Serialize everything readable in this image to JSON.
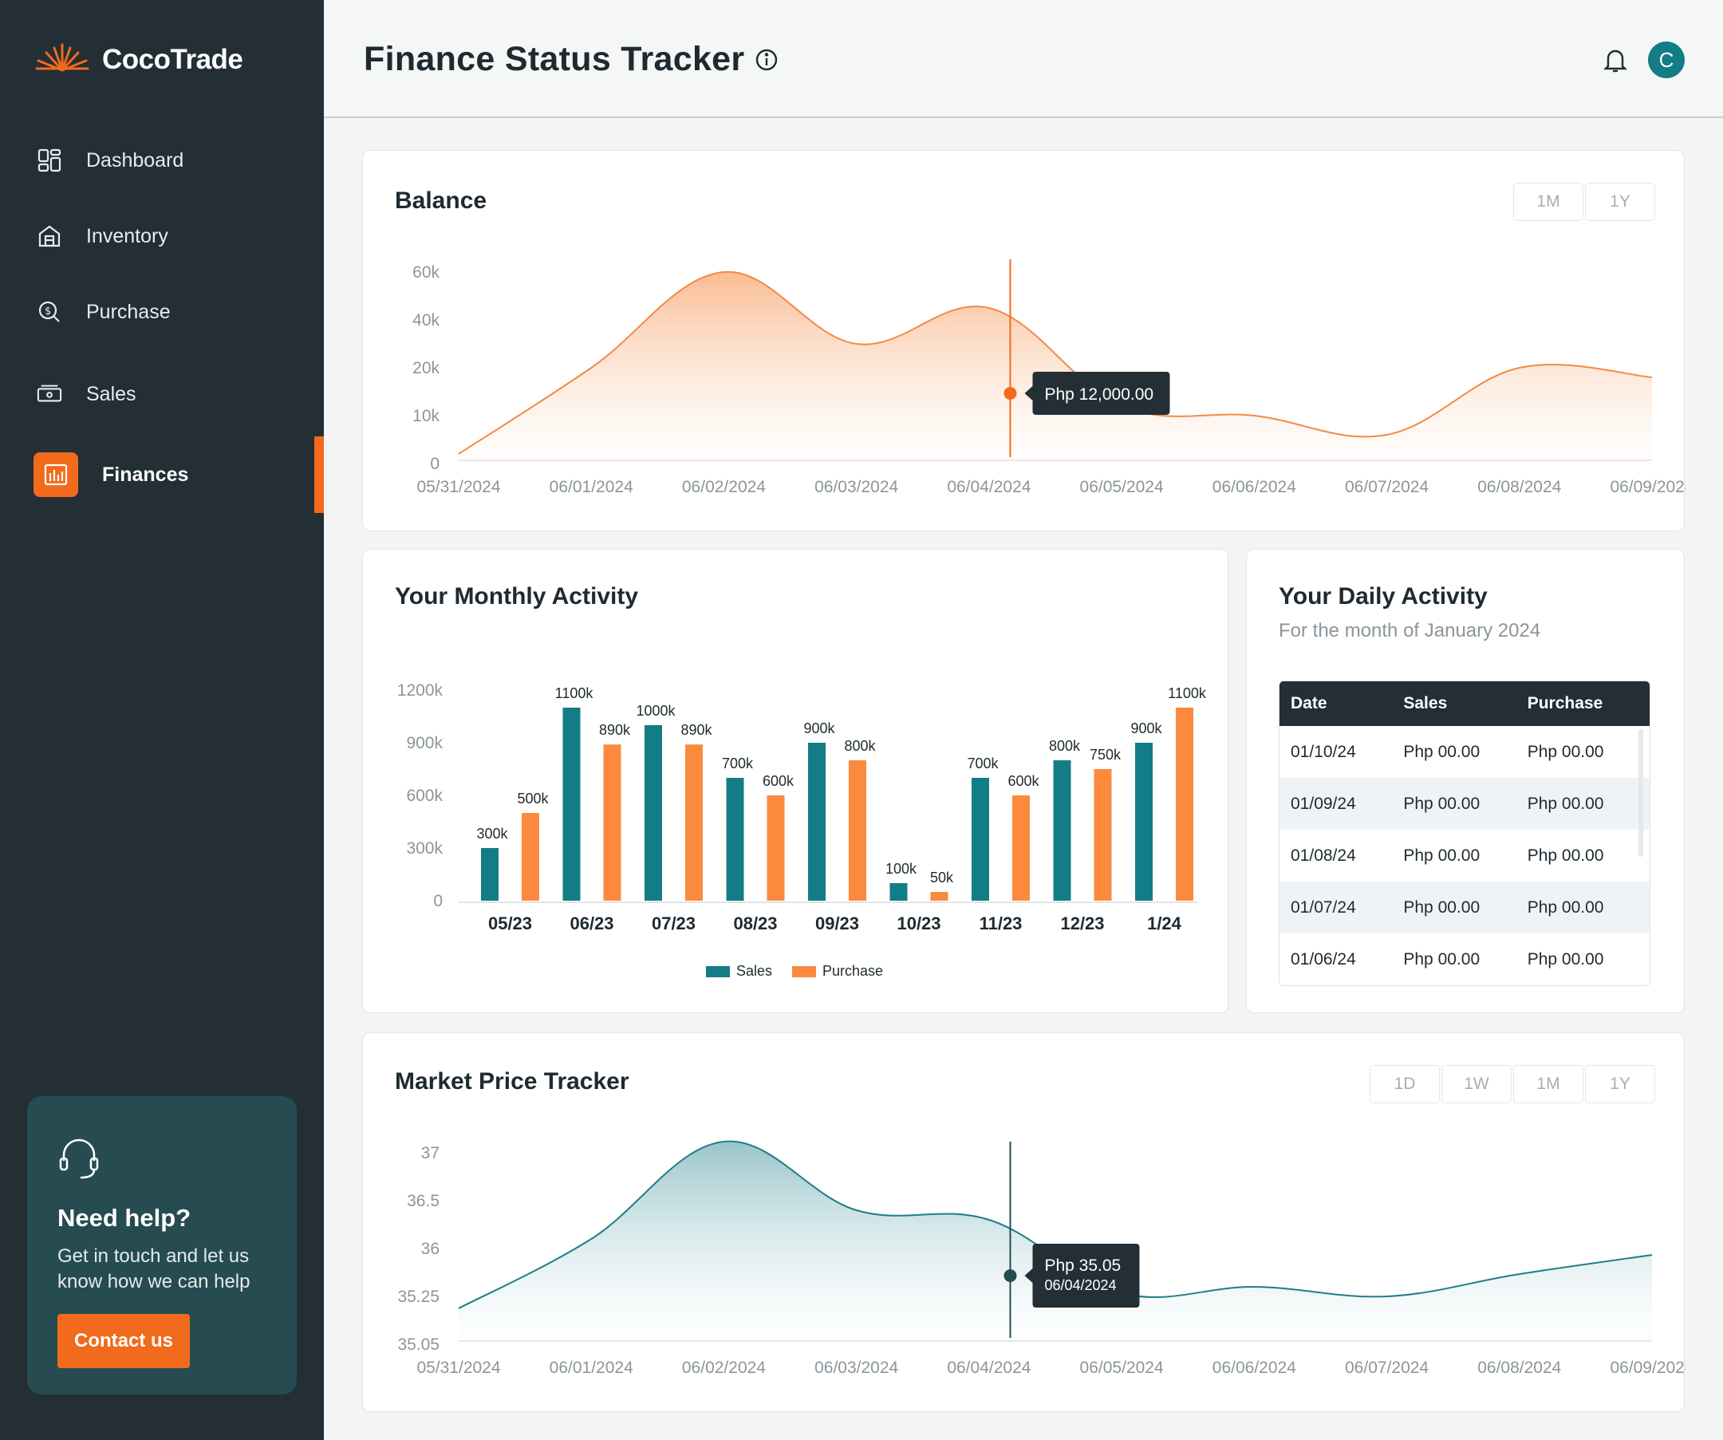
{
  "app": {
    "name": "CocoTrade"
  },
  "sidebar": {
    "items": [
      {
        "label": "Dashboard",
        "icon": "dashboard-icon"
      },
      {
        "label": "Inventory",
        "icon": "warehouse-icon"
      },
      {
        "label": "Purchase",
        "icon": "coin-search-icon"
      },
      {
        "label": "Sales",
        "icon": "cash-icon"
      },
      {
        "label": "Finances",
        "icon": "bar-chart-icon",
        "active": true
      }
    ],
    "help": {
      "title": "Need help?",
      "text": "Get in touch and let us know how we can help",
      "button": "Contact us"
    }
  },
  "header": {
    "title": "Finance Status Tracker",
    "avatar_initial": "C"
  },
  "colors": {
    "accent": "#f26a1b",
    "teal": "#127d86",
    "sidebar": "#232e35",
    "sales": "#127d86",
    "purchase": "#fb8a3e"
  },
  "balance": {
    "title": "Balance",
    "ranges": [
      "1M",
      "1Y"
    ],
    "y_ticks": [
      "60k",
      "40k",
      "20k",
      "10k",
      "0"
    ],
    "x_ticks": [
      "05/31/2024",
      "06/01/2024",
      "06/02/2024",
      "06/03/2024",
      "06/04/2024",
      "06/05/2024",
      "06/06/2024",
      "06/07/2024",
      "06/08/2024",
      "06/09/2024"
    ],
    "tooltip": "Php 12,000.00"
  },
  "monthly": {
    "title": "Your Monthly Activity",
    "y_ticks": [
      "1200k",
      "900k",
      "600k",
      "300k",
      "0"
    ],
    "legend": [
      "Sales",
      "Purchase"
    ]
  },
  "daily": {
    "title": "Your Daily Activity",
    "subtitle": "For the month of January 2024",
    "columns": [
      "Date",
      "Sales",
      "Purchase"
    ],
    "rows": [
      [
        "01/10/24",
        "Php 00.00",
        "Php 00.00"
      ],
      [
        "01/09/24",
        "Php 00.00",
        "Php 00.00"
      ],
      [
        "01/08/24",
        "Php 00.00",
        "Php 00.00"
      ],
      [
        "01/07/24",
        "Php 00.00",
        "Php 00.00"
      ],
      [
        "01/06/24",
        "Php 00.00",
        "Php 00.00"
      ]
    ]
  },
  "market": {
    "title": "Market Price Tracker",
    "ranges": [
      "1D",
      "1W",
      "1M",
      "1Y"
    ],
    "y_ticks": [
      "37",
      "36.5",
      "36",
      "35.25",
      "35.05"
    ],
    "x_ticks": [
      "05/31/2024",
      "06/01/2024",
      "06/02/2024",
      "06/03/2024",
      "06/04/2024",
      "06/05/2024",
      "06/06/2024",
      "06/07/2024",
      "06/08/2024",
      "06/09/2024"
    ],
    "tooltip_value": "Php 35.05",
    "tooltip_date": "06/04/2024"
  },
  "chart_data": [
    {
      "type": "area",
      "title": "Balance",
      "x": [
        "05/31/2024",
        "06/01/2024",
        "06/02/2024",
        "06/03/2024",
        "06/04/2024",
        "06/05/2024",
        "06/06/2024",
        "06/07/2024",
        "06/08/2024",
        "06/09/2024"
      ],
      "values": [
        2000,
        20000,
        60000,
        30000,
        45000,
        12000,
        10000,
        6000,
        20000,
        18000
      ],
      "highlight": {
        "x": "06/04/2024",
        "value": 12000
      }
    },
    {
      "type": "bar",
      "title": "Your Monthly Activity",
      "categories": [
        "05/23",
        "06/23",
        "07/23",
        "08/23",
        "09/23",
        "10/23",
        "11/23",
        "12/23",
        "1/24"
      ],
      "series": [
        {
          "name": "Sales",
          "values": [
            300,
            1100,
            1000,
            700,
            900,
            100,
            700,
            800,
            900
          ],
          "labels": [
            "300k",
            "1100k",
            "1000k",
            "700k",
            "900k",
            "100k",
            "700k",
            "800k",
            "900k"
          ]
        },
        {
          "name": "Purchase",
          "values": [
            500,
            890,
            890,
            600,
            800,
            50,
            600,
            750,
            1100
          ],
          "labels": [
            "500k",
            "890k",
            "890k",
            "600k",
            "800k",
            "50k",
            "600k",
            "750k",
            "1100k"
          ]
        }
      ],
      "ylim": [
        0,
        1200
      ]
    },
    {
      "type": "area",
      "title": "Market Price Tracker",
      "x": [
        "05/31/2024",
        "06/01/2024",
        "06/02/2024",
        "06/03/2024",
        "06/04/2024",
        "06/05/2024",
        "06/06/2024",
        "06/07/2024",
        "06/08/2024",
        "06/09/2024"
      ],
      "values": [
        35.2,
        36.1,
        37.1,
        36.4,
        36.3,
        35.3,
        35.4,
        35.25,
        35.6,
        35.9
      ],
      "highlight": {
        "x": "06/04/2024",
        "value": 35.05
      }
    }
  ]
}
